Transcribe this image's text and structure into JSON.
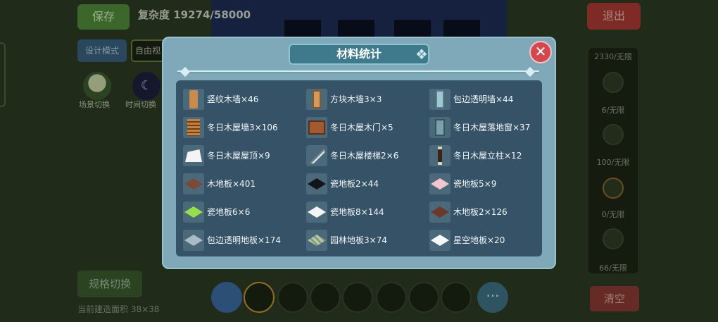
{
  "background": {
    "save_label": "保存",
    "complexity_text": "复杂度 19274/58000",
    "exit_label": "退出",
    "design_mode_label": "设计模式",
    "free_view_label": "自由视角",
    "scene_switch_label": "场景切换",
    "time_switch_label": "时间切换",
    "spec_switch_label": "规格切换",
    "build_area_text": "当前建造面积 38×38",
    "clear_label": "清空",
    "right_panel_counts": [
      "2330/无限",
      "6/无限",
      "100/无限",
      "0/无限",
      "66/无限"
    ],
    "more_label": "···"
  },
  "modal": {
    "title": "材料统计",
    "close_label": "✕",
    "items": [
      {
        "label": "竖纹木墙×46",
        "icon": "vertical-wood-wall-icon"
      },
      {
        "label": "方块木墙3×3",
        "icon": "block-wood-wall-icon"
      },
      {
        "label": "包边透明墙×44",
        "icon": "glass-wall-icon"
      },
      {
        "label": "冬日木屋墙3×106",
        "icon": "winter-cabin-wall-icon"
      },
      {
        "label": "冬日木屋木门×5",
        "icon": "winter-cabin-door-icon"
      },
      {
        "label": "冬日木屋落地窗×37",
        "icon": "winter-cabin-window-icon"
      },
      {
        "label": "冬日木屋屋顶×9",
        "icon": "winter-cabin-roof-icon"
      },
      {
        "label": "冬日木屋楼梯2×6",
        "icon": "winter-cabin-stairs-icon"
      },
      {
        "label": "冬日木屋立柱×12",
        "icon": "winter-cabin-pillar-icon"
      },
      {
        "label": "木地板×401",
        "icon": "wood-floor-icon"
      },
      {
        "label": "瓷地板2×44",
        "icon": "tile-floor-2-icon"
      },
      {
        "label": "瓷地板5×9",
        "icon": "tile-floor-5-icon"
      },
      {
        "label": "瓷地板6×6",
        "icon": "tile-floor-6-icon"
      },
      {
        "label": "瓷地板8×144",
        "icon": "tile-floor-8-icon"
      },
      {
        "label": "木地板2×126",
        "icon": "wood-floor-2-icon"
      },
      {
        "label": "包边透明地板×174",
        "icon": "glass-floor-icon"
      },
      {
        "label": "园林地板3×74",
        "icon": "garden-floor-icon"
      },
      {
        "label": "星空地板×20",
        "icon": "starry-floor-icon"
      }
    ]
  },
  "colors": {
    "modal_bg": "#7fa8b8",
    "grid_bg": "#355266",
    "close_red": "#d3474d",
    "title_banner": "#3e7a8c"
  }
}
